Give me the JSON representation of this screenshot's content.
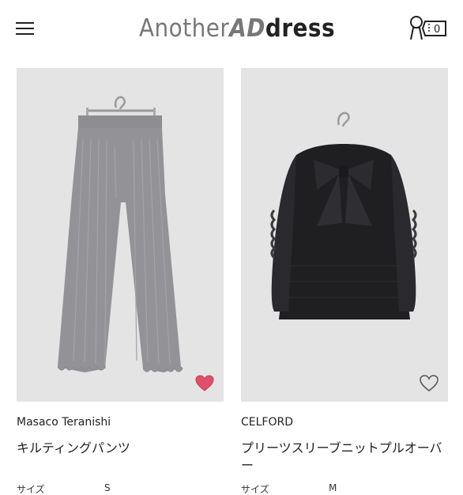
{
  "header": {
    "logo_part1": "Another",
    "logo_part2": "AD",
    "logo_part3": "dress",
    "menu_icon": "hamburger-menu-icon",
    "account_icon": "closet-account-icon",
    "closet_count": "0"
  },
  "products": [
    {
      "brand": "Masaco Teranishi",
      "name": "キルティングパンツ",
      "size_label": "サイズ",
      "size_value": "S",
      "favorited": true,
      "fav_color": "#e0506a"
    },
    {
      "brand": "CELFORD",
      "name": "プリーツスリーブニットプルオーバー",
      "size_label": "サイズ",
      "size_value": "M",
      "favorited": false,
      "fav_color": "#555555"
    }
  ]
}
